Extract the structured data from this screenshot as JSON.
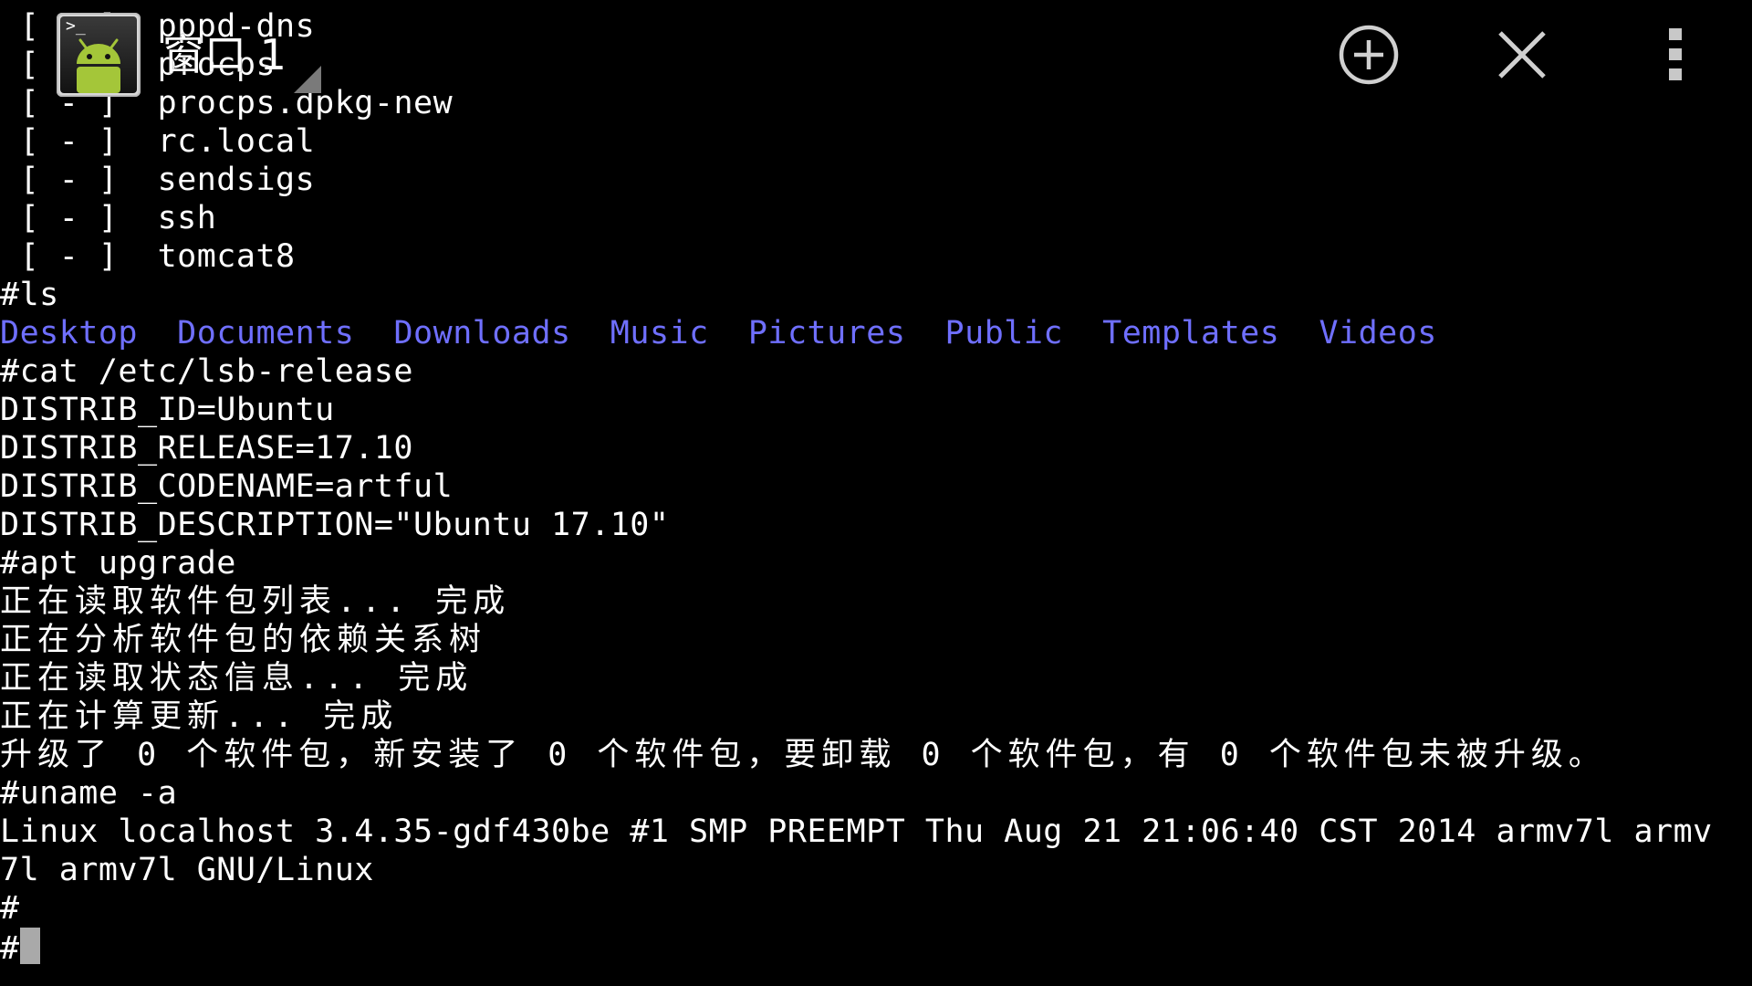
{
  "header": {
    "window_title": "窗口 1",
    "app_icon_prompt": ">_",
    "icons": {
      "app": "android-terminal-icon",
      "add": "add-circle-icon",
      "close": "close-icon",
      "more": "more-vertical-icon",
      "dropdown": "dropdown-triangle-icon"
    }
  },
  "terminal": {
    "colors": {
      "background": "#000000",
      "text": "#ffffff",
      "directory": "#6f6fff",
      "cursor": "#a9a9a9"
    },
    "service_lines": [
      {
        "status": " [ - ]",
        "name": "pppd-dns"
      },
      {
        "status": " [ - ]",
        "name": "procps"
      },
      {
        "status": " [ - ]",
        "name": "procps.dpkg-new"
      },
      {
        "status": " [ - ]",
        "name": "rc.local"
      },
      {
        "status": " [ - ]",
        "name": "sendsigs"
      },
      {
        "status": " [ - ]",
        "name": "ssh"
      },
      {
        "status": " [ - ]",
        "name": "tomcat8"
      }
    ],
    "cmd_ls": "#ls",
    "directories": [
      "Desktop",
      "Documents",
      "Downloads",
      "Music",
      "Pictures",
      "Public",
      "Templates",
      "Videos"
    ],
    "cmd_cat": "#cat /etc/lsb-release",
    "lsb_release": [
      "DISTRIB_ID=Ubuntu",
      "DISTRIB_RELEASE=17.10",
      "DISTRIB_CODENAME=artful",
      "DISTRIB_DESCRIPTION=\"Ubuntu 17.10\""
    ],
    "cmd_apt": "#apt upgrade",
    "apt_output": [
      "正在读取软件包列表... 完成",
      "正在分析软件包的依赖关系树",
      "正在读取状态信息... 完成",
      "正在计算更新... 完成",
      "升级了 0 个软件包，新安装了 0 个软件包，要卸载 0 个软件包，有 0 个软件包未被升级。"
    ],
    "cmd_uname": "#uname -a",
    "uname_output": [
      "Linux localhost 3.4.35-gdf430be #1 SMP PREEMPT Thu Aug 21 21:06:40 CST 2014 armv7l armv",
      "7l armv7l GNU/Linux"
    ],
    "prompt_empty": "#",
    "prompt_current": "#"
  }
}
